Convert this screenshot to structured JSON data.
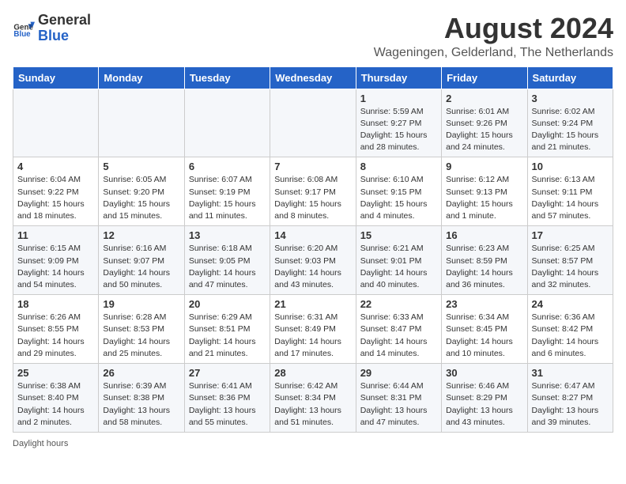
{
  "header": {
    "logo_general": "General",
    "logo_blue": "Blue",
    "month_year": "August 2024",
    "location": "Wageningen, Gelderland, The Netherlands"
  },
  "days_of_week": [
    "Sunday",
    "Monday",
    "Tuesday",
    "Wednesday",
    "Thursday",
    "Friday",
    "Saturday"
  ],
  "weeks": [
    [
      {
        "day": "",
        "detail": ""
      },
      {
        "day": "",
        "detail": ""
      },
      {
        "day": "",
        "detail": ""
      },
      {
        "day": "",
        "detail": ""
      },
      {
        "day": "1",
        "detail": "Sunrise: 5:59 AM\nSunset: 9:27 PM\nDaylight: 15 hours\nand 28 minutes."
      },
      {
        "day": "2",
        "detail": "Sunrise: 6:01 AM\nSunset: 9:26 PM\nDaylight: 15 hours\nand 24 minutes."
      },
      {
        "day": "3",
        "detail": "Sunrise: 6:02 AM\nSunset: 9:24 PM\nDaylight: 15 hours\nand 21 minutes."
      }
    ],
    [
      {
        "day": "4",
        "detail": "Sunrise: 6:04 AM\nSunset: 9:22 PM\nDaylight: 15 hours\nand 18 minutes."
      },
      {
        "day": "5",
        "detail": "Sunrise: 6:05 AM\nSunset: 9:20 PM\nDaylight: 15 hours\nand 15 minutes."
      },
      {
        "day": "6",
        "detail": "Sunrise: 6:07 AM\nSunset: 9:19 PM\nDaylight: 15 hours\nand 11 minutes."
      },
      {
        "day": "7",
        "detail": "Sunrise: 6:08 AM\nSunset: 9:17 PM\nDaylight: 15 hours\nand 8 minutes."
      },
      {
        "day": "8",
        "detail": "Sunrise: 6:10 AM\nSunset: 9:15 PM\nDaylight: 15 hours\nand 4 minutes."
      },
      {
        "day": "9",
        "detail": "Sunrise: 6:12 AM\nSunset: 9:13 PM\nDaylight: 15 hours\nand 1 minute."
      },
      {
        "day": "10",
        "detail": "Sunrise: 6:13 AM\nSunset: 9:11 PM\nDaylight: 14 hours\nand 57 minutes."
      }
    ],
    [
      {
        "day": "11",
        "detail": "Sunrise: 6:15 AM\nSunset: 9:09 PM\nDaylight: 14 hours\nand 54 minutes."
      },
      {
        "day": "12",
        "detail": "Sunrise: 6:16 AM\nSunset: 9:07 PM\nDaylight: 14 hours\nand 50 minutes."
      },
      {
        "day": "13",
        "detail": "Sunrise: 6:18 AM\nSunset: 9:05 PM\nDaylight: 14 hours\nand 47 minutes."
      },
      {
        "day": "14",
        "detail": "Sunrise: 6:20 AM\nSunset: 9:03 PM\nDaylight: 14 hours\nand 43 minutes."
      },
      {
        "day": "15",
        "detail": "Sunrise: 6:21 AM\nSunset: 9:01 PM\nDaylight: 14 hours\nand 40 minutes."
      },
      {
        "day": "16",
        "detail": "Sunrise: 6:23 AM\nSunset: 8:59 PM\nDaylight: 14 hours\nand 36 minutes."
      },
      {
        "day": "17",
        "detail": "Sunrise: 6:25 AM\nSunset: 8:57 PM\nDaylight: 14 hours\nand 32 minutes."
      }
    ],
    [
      {
        "day": "18",
        "detail": "Sunrise: 6:26 AM\nSunset: 8:55 PM\nDaylight: 14 hours\nand 29 minutes."
      },
      {
        "day": "19",
        "detail": "Sunrise: 6:28 AM\nSunset: 8:53 PM\nDaylight: 14 hours\nand 25 minutes."
      },
      {
        "day": "20",
        "detail": "Sunrise: 6:29 AM\nSunset: 8:51 PM\nDaylight: 14 hours\nand 21 minutes."
      },
      {
        "day": "21",
        "detail": "Sunrise: 6:31 AM\nSunset: 8:49 PM\nDaylight: 14 hours\nand 17 minutes."
      },
      {
        "day": "22",
        "detail": "Sunrise: 6:33 AM\nSunset: 8:47 PM\nDaylight: 14 hours\nand 14 minutes."
      },
      {
        "day": "23",
        "detail": "Sunrise: 6:34 AM\nSunset: 8:45 PM\nDaylight: 14 hours\nand 10 minutes."
      },
      {
        "day": "24",
        "detail": "Sunrise: 6:36 AM\nSunset: 8:42 PM\nDaylight: 14 hours\nand 6 minutes."
      }
    ],
    [
      {
        "day": "25",
        "detail": "Sunrise: 6:38 AM\nSunset: 8:40 PM\nDaylight: 14 hours\nand 2 minutes."
      },
      {
        "day": "26",
        "detail": "Sunrise: 6:39 AM\nSunset: 8:38 PM\nDaylight: 13 hours\nand 58 minutes."
      },
      {
        "day": "27",
        "detail": "Sunrise: 6:41 AM\nSunset: 8:36 PM\nDaylight: 13 hours\nand 55 minutes."
      },
      {
        "day": "28",
        "detail": "Sunrise: 6:42 AM\nSunset: 8:34 PM\nDaylight: 13 hours\nand 51 minutes."
      },
      {
        "day": "29",
        "detail": "Sunrise: 6:44 AM\nSunset: 8:31 PM\nDaylight: 13 hours\nand 47 minutes."
      },
      {
        "day": "30",
        "detail": "Sunrise: 6:46 AM\nSunset: 8:29 PM\nDaylight: 13 hours\nand 43 minutes."
      },
      {
        "day": "31",
        "detail": "Sunrise: 6:47 AM\nSunset: 8:27 PM\nDaylight: 13 hours\nand 39 minutes."
      }
    ]
  ],
  "footer": {
    "note": "Daylight hours"
  }
}
